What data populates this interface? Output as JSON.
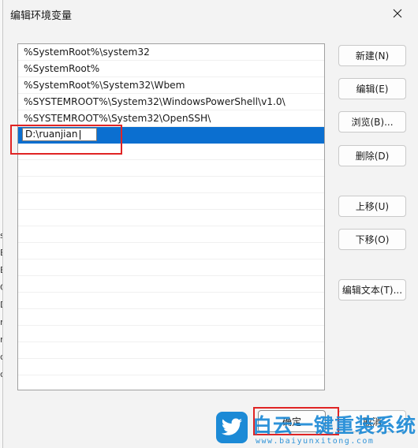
{
  "dialog": {
    "title": "编辑环境变量"
  },
  "list": {
    "items": [
      "%SystemRoot%\\system32",
      "%SystemRoot%",
      "%SystemRoot%\\System32\\Wbem",
      "%SYSTEMROOT%\\System32\\WindowsPowerShell\\v1.0\\",
      "%SYSTEMROOT%\\System32\\OpenSSH\\"
    ],
    "editing_value": "D:\\ruanjian"
  },
  "buttons": {
    "new": "新建(N)",
    "edit": "编辑(E)",
    "browse": "浏览(B)...",
    "delete": "删除(D)",
    "move_up": "上移(U)",
    "move_down": "下移(O)",
    "edit_text": "编辑文本(T)...",
    "ok": "确定",
    "cancel": "取消"
  },
  "background_fragments": [
    "s",
    "E",
    "E",
    "C",
    "D",
    "r",
    "r",
    "c",
    "c"
  ],
  "watermark": {
    "brand": "白云一键重装系统",
    "url": "www.baiyunxitong.com"
  },
  "colors": {
    "selection": "#0b6fd0",
    "highlight": "#e02424",
    "watermark": "#1c8ad6"
  }
}
